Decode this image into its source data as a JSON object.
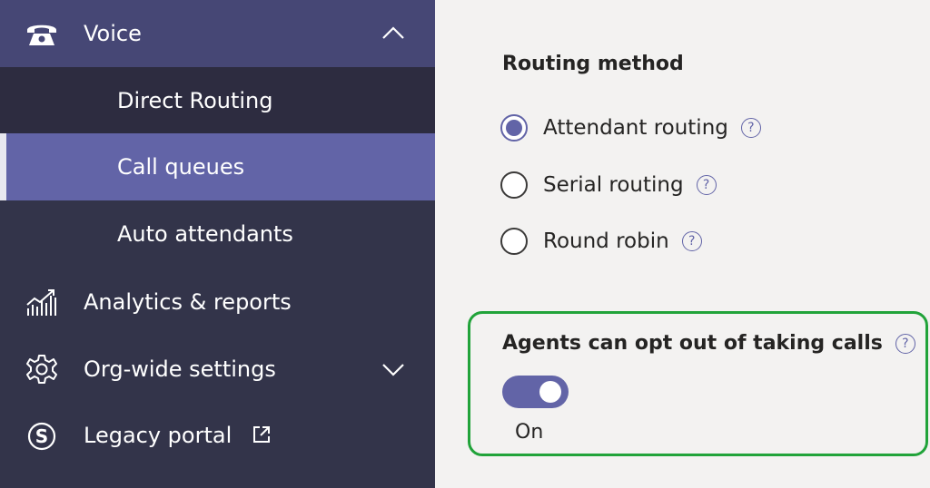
{
  "sidebar": {
    "items": [
      {
        "label": "Voice",
        "icon": "phone-icon",
        "expanded": true
      },
      {
        "label": "Direct Routing",
        "sub": true
      },
      {
        "label": "Call queues",
        "sub": true,
        "selected": true
      },
      {
        "label": "Auto attendants",
        "sub": true
      },
      {
        "label": "Analytics & reports",
        "icon": "analytics-icon"
      },
      {
        "label": "Org-wide settings",
        "icon": "gear-icon",
        "expanded": false
      },
      {
        "label": "Legacy portal",
        "icon": "skype-icon",
        "external": true
      }
    ]
  },
  "routing": {
    "title": "Routing method",
    "options": [
      {
        "label": "Attendant routing",
        "checked": true
      },
      {
        "label": "Serial routing",
        "checked": false
      },
      {
        "label": "Round robin",
        "checked": false
      }
    ],
    "help_glyph": "?"
  },
  "opt_out": {
    "title": "Agents can opt out of taking calls",
    "toggle_state": "On",
    "enabled": true
  },
  "colors": {
    "sidebar_bg": "#33344a",
    "selected_bg": "#6264a7",
    "accent": "#6264a7",
    "highlight_border": "#21a33a"
  }
}
